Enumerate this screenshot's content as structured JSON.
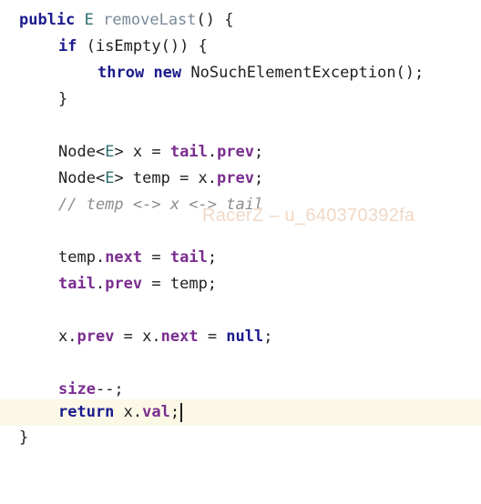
{
  "code": {
    "line1": {
      "kw1": "public",
      "type": "E",
      "fn": "removeLast",
      "rest": "() {"
    },
    "line2": {
      "kw": "if",
      "rest": " (isEmpty()) {"
    },
    "line3": {
      "kw1": "throw",
      "kw2": "new",
      "rest": " NoSuchElementException();"
    },
    "line4": {
      "text": "}"
    },
    "line5": {
      "pre": "Node<",
      "type": "E",
      "mid": "> x = ",
      "f1": "tail",
      "dot": ".",
      "f2": "prev",
      "end": ";"
    },
    "line6": {
      "pre": "Node<",
      "type": "E",
      "mid": "> temp = x.",
      "f2": "prev",
      "end": ";"
    },
    "line7": {
      "comment": "// temp <-> x <-> tail"
    },
    "line8": {
      "pre": "temp.",
      "f1": "next",
      "mid": " = ",
      "f2": "tail",
      "end": ";"
    },
    "line9": {
      "f1": "tail",
      "dot": ".",
      "f2": "prev",
      "end": " = temp;"
    },
    "line10": {
      "pre": "x.",
      "f1": "prev",
      "mid": " = x.",
      "f2": "next",
      "mid2": " = ",
      "kw": "null",
      "end": ";"
    },
    "line11": {
      "f1": "size",
      "end": "--;"
    },
    "line12": {
      "kw": "return",
      "mid": " x.",
      "f1": "val",
      "end": ";"
    },
    "line13": {
      "text": "}"
    }
  },
  "watermark": "RacerZ – u_640370392fa"
}
